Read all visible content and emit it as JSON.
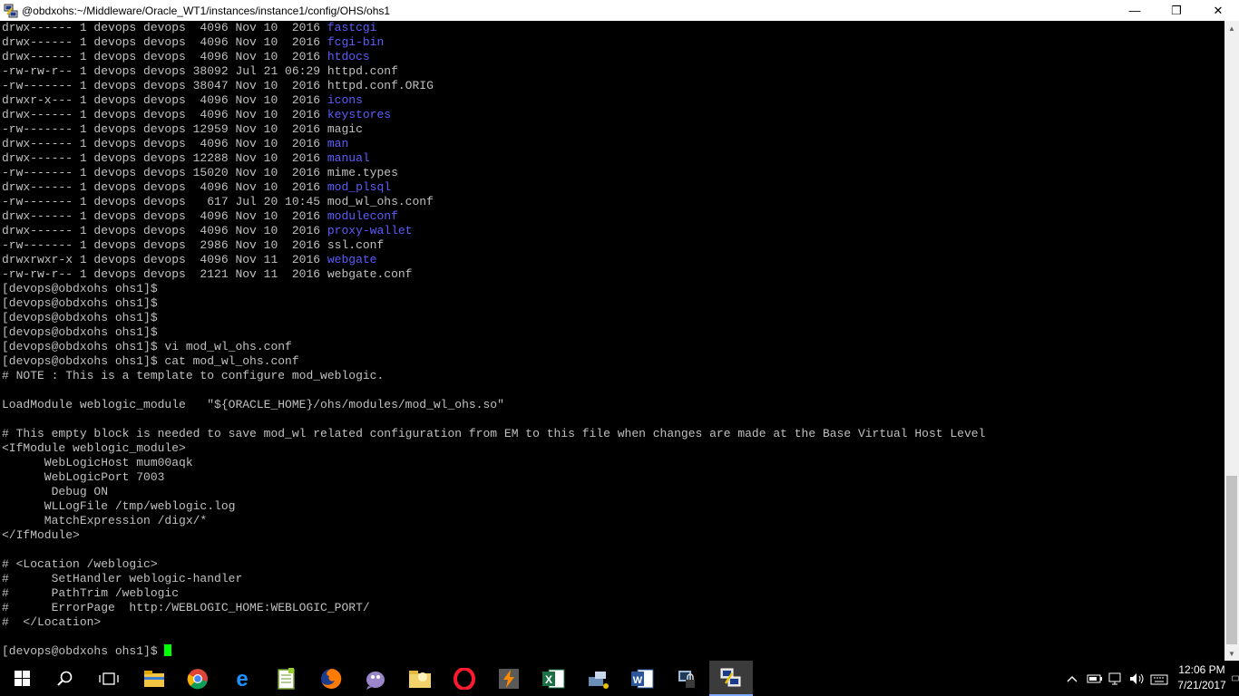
{
  "window": {
    "title": "@obdxohs:~/Middleware/Oracle_WT1/instances/instance1/config/OHS/ohs1",
    "icon": "putty-icon",
    "controls": {
      "minimize": "—",
      "maximize": "❐",
      "close": "✕"
    }
  },
  "terminal": {
    "colors": {
      "background": "#000000",
      "text": "#c0c0c0",
      "directory": "#5c5cff",
      "cursor": "#00ff00"
    },
    "lines": [
      {
        "pre": "drwx------ 1 devops devops  4096 Nov 10  2016 ",
        "name": "fastcgi",
        "type": "dir"
      },
      {
        "pre": "drwx------ 1 devops devops  4096 Nov 10  2016 ",
        "name": "fcgi-bin",
        "type": "dir"
      },
      {
        "pre": "drwx------ 1 devops devops  4096 Nov 10  2016 ",
        "name": "htdocs",
        "type": "dir"
      },
      {
        "pre": "-rw-rw-r-- 1 devops devops 38092 Jul 21 06:29 ",
        "name": "httpd.conf",
        "type": "file"
      },
      {
        "pre": "-rw------- 1 devops devops 38047 Nov 10  2016 ",
        "name": "httpd.conf.ORIG",
        "type": "file"
      },
      {
        "pre": "drwxr-x--- 1 devops devops  4096 Nov 10  2016 ",
        "name": "icons",
        "type": "dir"
      },
      {
        "pre": "drwx------ 1 devops devops  4096 Nov 10  2016 ",
        "name": "keystores",
        "type": "dir"
      },
      {
        "pre": "-rw------- 1 devops devops 12959 Nov 10  2016 ",
        "name": "magic",
        "type": "file"
      },
      {
        "pre": "drwx------ 1 devops devops  4096 Nov 10  2016 ",
        "name": "man",
        "type": "dir"
      },
      {
        "pre": "drwx------ 1 devops devops 12288 Nov 10  2016 ",
        "name": "manual",
        "type": "dir"
      },
      {
        "pre": "-rw------- 1 devops devops 15020 Nov 10  2016 ",
        "name": "mime.types",
        "type": "file"
      },
      {
        "pre": "drwx------ 1 devops devops  4096 Nov 10  2016 ",
        "name": "mod_plsql",
        "type": "dir"
      },
      {
        "pre": "-rw------- 1 devops devops   617 Jul 20 10:45 ",
        "name": "mod_wl_ohs.conf",
        "type": "file"
      },
      {
        "pre": "drwx------ 1 devops devops  4096 Nov 10  2016 ",
        "name": "moduleconf",
        "type": "dir"
      },
      {
        "pre": "drwx------ 1 devops devops  4096 Nov 10  2016 ",
        "name": "proxy-wallet",
        "type": "dir"
      },
      {
        "pre": "-rw------- 1 devops devops  2986 Nov 10  2016 ",
        "name": "ssl.conf",
        "type": "file"
      },
      {
        "pre": "drwxrwxr-x 1 devops devops  4096 Nov 11  2016 ",
        "name": "webgate",
        "type": "dir"
      },
      {
        "pre": "-rw-rw-r-- 1 devops devops  2121 Nov 11  2016 ",
        "name": "webgate.conf",
        "type": "file"
      },
      {
        "pre": "[devops@obdxohs ohs1]$",
        "name": "",
        "type": "text"
      },
      {
        "pre": "[devops@obdxohs ohs1]$",
        "name": "",
        "type": "text"
      },
      {
        "pre": "[devops@obdxohs ohs1]$",
        "name": "",
        "type": "text"
      },
      {
        "pre": "[devops@obdxohs ohs1]$",
        "name": "",
        "type": "text"
      },
      {
        "pre": "[devops@obdxohs ohs1]$ vi mod_wl_ohs.conf",
        "name": "",
        "type": "text"
      },
      {
        "pre": "[devops@obdxohs ohs1]$ cat mod_wl_ohs.conf",
        "name": "",
        "type": "text"
      },
      {
        "pre": "# NOTE : This is a template to configure mod_weblogic.",
        "name": "",
        "type": "text"
      },
      {
        "pre": "",
        "name": "",
        "type": "text"
      },
      {
        "pre": "LoadModule weblogic_module   \"${ORACLE_HOME}/ohs/modules/mod_wl_ohs.so\"",
        "name": "",
        "type": "text"
      },
      {
        "pre": "",
        "name": "",
        "type": "text"
      },
      {
        "pre": "# This empty block is needed to save mod_wl related configuration from EM to this file when changes are made at the Base Virtual Host Level",
        "name": "",
        "type": "text"
      },
      {
        "pre": "<IfModule weblogic_module>",
        "name": "",
        "type": "text"
      },
      {
        "pre": "      WebLogicHost mum00aqk",
        "name": "",
        "type": "text"
      },
      {
        "pre": "      WebLogicPort 7003",
        "name": "",
        "type": "text"
      },
      {
        "pre": "       Debug ON",
        "name": "",
        "type": "text"
      },
      {
        "pre": "      WLLogFile /tmp/weblogic.log",
        "name": "",
        "type": "text"
      },
      {
        "pre": "      MatchExpression /digx/*",
        "name": "",
        "type": "text"
      },
      {
        "pre": "</IfModule>",
        "name": "",
        "type": "text"
      },
      {
        "pre": "",
        "name": "",
        "type": "text"
      },
      {
        "pre": "# <Location /weblogic>",
        "name": "",
        "type": "text"
      },
      {
        "pre": "#      SetHandler weblogic-handler",
        "name": "",
        "type": "text"
      },
      {
        "pre": "#      PathTrim /weblogic",
        "name": "",
        "type": "text"
      },
      {
        "pre": "#      ErrorPage  http:/WEBLOGIC_HOME:WEBLOGIC_PORT/",
        "name": "",
        "type": "text"
      },
      {
        "pre": "#  </Location>",
        "name": "",
        "type": "text"
      },
      {
        "pre": "",
        "name": "",
        "type": "text"
      },
      {
        "pre": "[devops@obdxohs ohs1]$ ",
        "name": "",
        "type": "prompt"
      }
    ]
  },
  "taskbar": {
    "items": [
      {
        "icon": "windows-start-icon"
      },
      {
        "icon": "search-icon"
      },
      {
        "icon": "task-view-icon"
      },
      {
        "icon": "file-explorer-icon"
      },
      {
        "icon": "chrome-icon"
      },
      {
        "icon": "edge-icon"
      },
      {
        "icon": "notepad-plus-plus-icon"
      },
      {
        "icon": "firefox-icon"
      },
      {
        "icon": "pidgin-icon"
      },
      {
        "icon": "folder-app-icon"
      },
      {
        "icon": "opera-icon"
      },
      {
        "icon": "flash-app-icon"
      },
      {
        "icon": "excel-icon"
      },
      {
        "icon": "network-tool-icon"
      },
      {
        "icon": "word-icon"
      },
      {
        "icon": "secure-app-icon"
      },
      {
        "icon": "putty-icon",
        "active": true
      }
    ],
    "tray_icons": [
      "chevron-up-icon",
      "battery-icon",
      "network-icon",
      "volume-icon",
      "keyboard-icon"
    ],
    "clock": {
      "time": "12:06 PM",
      "date": "7/21/2017"
    },
    "notification_icon": "notification-icon"
  }
}
